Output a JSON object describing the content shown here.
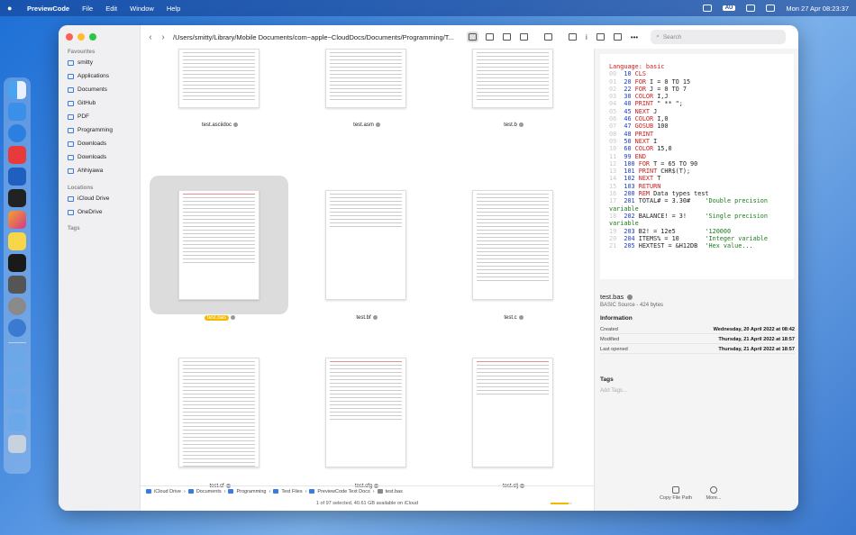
{
  "menubar": {
    "app_name": "PreviewCode",
    "items": [
      "File",
      "Edit",
      "Window",
      "Help"
    ],
    "badge": "AU",
    "clock": "Mon 27 Apr  08:23:37"
  },
  "toolbar": {
    "path": "/Users/smitty/Library/Mobile Documents/com~apple~CloudDocs/Documents/Programming/T...",
    "search_placeholder": "Search"
  },
  "sidebar": {
    "favourites_title": "Favourites",
    "favourites": [
      "smitty",
      "Applications",
      "Documents",
      "GitHub",
      "PDF",
      "Programming",
      "Downloads",
      "Downloads",
      "Ahhiyawa"
    ],
    "locations_title": "Locations",
    "locations": [
      "iCloud Drive",
      "OneDrive"
    ],
    "tags_title": "Tags"
  },
  "files": [
    {
      "name": "test.asciidoc"
    },
    {
      "name": "test.asm"
    },
    {
      "name": "test.b"
    },
    {
      "name": "test.bas",
      "selected": true
    },
    {
      "name": "test.bf"
    },
    {
      "name": "test.c"
    },
    {
      "name": "test.cf"
    },
    {
      "name": "test.cfg"
    },
    {
      "name": "test.clj"
    }
  ],
  "pathbar": {
    "segments": [
      "iCloud Drive",
      "Documents",
      "Programming",
      "Test Files",
      "PreviewCode Text Docs",
      "test.bas"
    ]
  },
  "status": {
    "text": "1 of 97 selected, 40.61 GB available on iCloud",
    "progress": 0.85
  },
  "inspector": {
    "language_line": "Language: basic",
    "code": [
      {
        "n": "00",
        "num": "10",
        "kw": "CLS",
        "rest": ""
      },
      {
        "n": "01",
        "num": "20",
        "kw": "FOR",
        "rest": " I = 0 TO 15"
      },
      {
        "n": "02",
        "num": "22",
        "kw": "FOR",
        "rest": " J = 0 TO 7"
      },
      {
        "n": "03",
        "num": "30",
        "kw": "COLOR",
        "rest": " I,J"
      },
      {
        "n": "04",
        "num": "40",
        "kw": "PRINT",
        "rest": " \" ** \";"
      },
      {
        "n": "05",
        "num": "45",
        "kw": "NEXT",
        "rest": " J"
      },
      {
        "n": "06",
        "num": "46",
        "kw": "COLOR",
        "rest": " I,0"
      },
      {
        "n": "07",
        "num": "47",
        "kw": "GOSUB",
        "rest": " 100"
      },
      {
        "n": "08",
        "num": "48",
        "kw": "PRINT",
        "rest": ""
      },
      {
        "n": "09",
        "num": "50",
        "kw": "NEXT",
        "rest": " I"
      },
      {
        "n": "10",
        "num": "60",
        "kw": "COLOR",
        "rest": " 15,0"
      },
      {
        "n": "11",
        "num": "99",
        "kw": "END",
        "rest": ""
      },
      {
        "n": "12",
        "num": "100",
        "kw": "FOR",
        "rest": " T = 65 TO 90"
      },
      {
        "n": "13",
        "num": "101",
        "kw": "PRINT",
        "rest": " CHR$(T);"
      },
      {
        "n": "14",
        "num": "102",
        "kw": "NEXT",
        "rest": " T"
      },
      {
        "n": "15",
        "num": "103",
        "kw": "RETURN",
        "rest": ""
      },
      {
        "n": "16",
        "num": "200",
        "kw": "REM",
        "rest": " Data types test"
      },
      {
        "n": "17",
        "num": "201",
        "kw": "",
        "rest": "TOTAL# = 3.30#    'Double precision"
      },
      {
        "n": "",
        "num": "",
        "kw": "",
        "rest": "variable"
      },
      {
        "n": "18",
        "num": "202",
        "kw": "",
        "rest": "BALANCE! = 3!     'Single precision"
      },
      {
        "n": "",
        "num": "",
        "kw": "",
        "rest": "variable"
      },
      {
        "n": "19",
        "num": "203",
        "kw": "",
        "rest": "B2! = 12e5        '120000"
      },
      {
        "n": "20",
        "num": "204",
        "kw": "",
        "rest": "ITEMS% = 10       'Integer variable"
      },
      {
        "n": "21",
        "num": "205",
        "kw": "",
        "rest": "HEXTEST = &H12DB  'Hex value..."
      }
    ],
    "file_name": "test.bas",
    "file_sub": "BASIC Source - 424 bytes",
    "information_title": "Information",
    "rows": [
      {
        "label": "Created",
        "value": "Wednesday, 20 April 2022 at 08:42"
      },
      {
        "label": "Modified",
        "value": "Thursday, 21 April 2022 at 18:57"
      },
      {
        "label": "Last opened",
        "value": "Thursday, 21 April 2022 at 18:57"
      }
    ],
    "tags_title": "Tags",
    "tags_placeholder": "Add Tags...",
    "btn_copy": "Copy File Path",
    "btn_more": "More..."
  },
  "colors": {
    "accent": "#3b7be0",
    "selection_label": "#f5b800"
  }
}
